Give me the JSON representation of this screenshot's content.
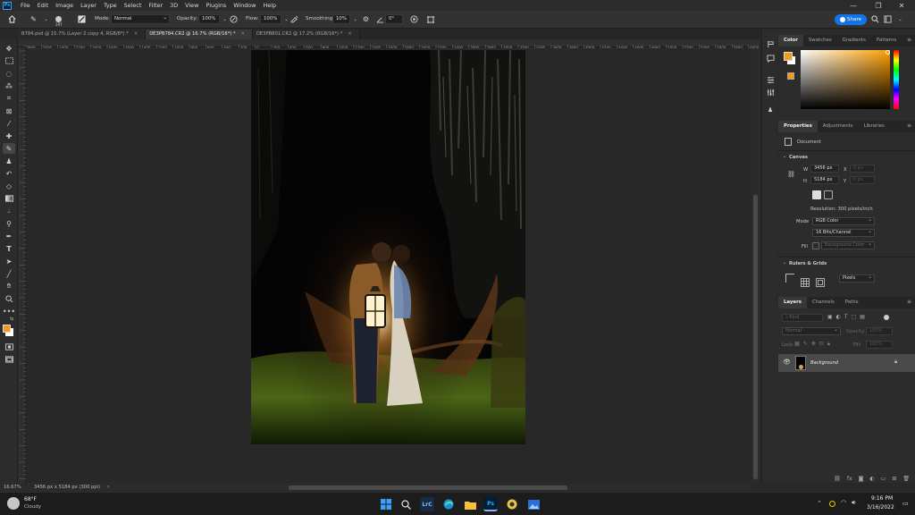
{
  "menu": {
    "logo": "Ps",
    "items": [
      "File",
      "Edit",
      "Image",
      "Layer",
      "Type",
      "Select",
      "Filter",
      "3D",
      "View",
      "Plugins",
      "Window",
      "Help"
    ],
    "window_controls": [
      "—",
      "❐",
      "✕"
    ]
  },
  "options": {
    "brush_size": "197",
    "mode_label": "Mode:",
    "mode_value": "Normal",
    "opacity_label": "Opacity:",
    "opacity_value": "100%",
    "flow_label": "Flow:",
    "flow_value": "100%",
    "smoothing_label": "Smoothing:",
    "smoothing_value": "10%",
    "angle_value": "0°",
    "share_label": "Share"
  },
  "tabs": [
    {
      "label": "B784.psd @ 15.7% (Layer 2 copy 4, RGB/8*) *",
      "active": false
    },
    {
      "label": "DE3PB784.CR2 @ 16.7% (RGB/16*) *",
      "active": true
    },
    {
      "label": "DE3PB801.CR2 @ 17.2% (RGB/16*) *",
      "active": false
    }
  ],
  "ruler_ticks": [
    "2800",
    "2600",
    "2400",
    "2200",
    "2000",
    "1800",
    "1600",
    "1400",
    "1200",
    "1000",
    "800",
    "600",
    "400",
    "200",
    "0",
    "200",
    "400",
    "600",
    "800",
    "1000",
    "1200",
    "1400",
    "1600",
    "1800",
    "2000",
    "2200",
    "2400",
    "2600",
    "2800",
    "3000",
    "3200",
    "3400",
    "3600",
    "3800",
    "4000",
    "4200",
    "4400",
    "4600",
    "4800",
    "5000",
    "5200",
    "5400",
    "5600",
    "5800",
    "6000",
    "6200"
  ],
  "status": {
    "zoom": "16.67%",
    "doc_info": "3456 px x 5184 px (300 ppi)"
  },
  "color_panel": {
    "tabs": [
      "Color",
      "Swatches",
      "Gradients",
      "Patterns"
    ],
    "foreground": "#f29a1a",
    "background": "#ffffff"
  },
  "properties_panel": {
    "tabs": [
      "Properties",
      "Adjustments",
      "Libraries"
    ],
    "document_label": "Document",
    "canvas_section": "Canvas",
    "w_label": "W",
    "w_value": "3456 px",
    "x_label": "X",
    "x_value": "0 px",
    "h_label": "H",
    "h_value": "5184 px",
    "y_label": "Y",
    "y_value": "0 px",
    "resolution": "Resolution: 300 pixels/inch",
    "mode_label": "Mode",
    "mode_value": "RGB Color",
    "depth_value": "16 Bits/Channel",
    "fill_label": "Fill",
    "fill_value": "Background Color",
    "rulers_section": "Rulers & Grids",
    "units_value": "Pixels"
  },
  "layers_panel": {
    "tabs": [
      "Layers",
      "Channels",
      "Paths"
    ],
    "kind_placeholder": "Kind",
    "blend_value": "Normal",
    "opacity_label": "Opacity:",
    "opacity_value": "100%",
    "lock_label": "Lock:",
    "fill_label": "Fill:",
    "fill_value": "100%",
    "layer_name": "Background"
  },
  "taskbar": {
    "temp": "68°F",
    "weather": "Cloudy",
    "time": "9:16 PM",
    "date": "3/16/2022"
  }
}
